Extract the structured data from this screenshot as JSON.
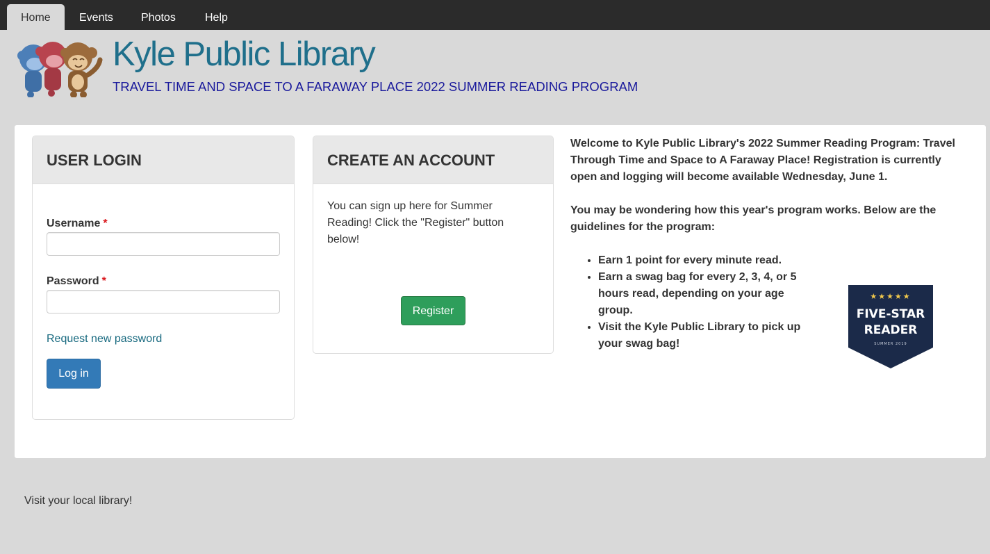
{
  "nav": {
    "tabs": [
      "Home",
      "Events",
      "Photos",
      "Help"
    ],
    "active": "Home"
  },
  "header": {
    "title": "Kyle Public Library",
    "slogan": "TRAVEL TIME AND SPACE TO A FARAWAY PLACE 2022 SUMMER READING PROGRAM"
  },
  "login": {
    "heading": "USER LOGIN",
    "username_label": "Username",
    "password_label": "Password",
    "required_mark": "*",
    "username_value": "",
    "password_value": "",
    "forgot_link": "Request new password",
    "submit_label": "Log in"
  },
  "create": {
    "heading": "CREATE AN ACCOUNT",
    "text": "You can sign up here for Summer Reading!  Click the \"Register\" button below!",
    "button_label": "Register"
  },
  "info": {
    "paragraph1": "Welcome to Kyle Public Library's 2022 Summer Reading Program: Travel Through Time and Space to A Faraway Place! Registration is currently open and logging will become available Wednesday, June 1.",
    "paragraph2": "You may be wondering how this year's program works. Below are the guidelines for the program:",
    "guidelines": [
      "Earn 1 point for every minute read.",
      "Earn a swag bag for every 2, 3, 4, or 5 hours read, depending on your age group.",
      "Visit the Kyle Public Library to pick up your swag bag!"
    ]
  },
  "badge": {
    "stars": "★★★★★",
    "line1": "FIVE-STAR",
    "line2": "READER",
    "line3": "SUMMER 2019"
  },
  "footer": {
    "text": "Visit your local library!"
  },
  "colors": {
    "title": "#1f6f8b",
    "slogan": "#1a1a9c",
    "login_button": "#337ab7",
    "register_button": "#2e9e5b",
    "badge_bg": "#1b2a49",
    "badge_star": "#f2c94c"
  }
}
